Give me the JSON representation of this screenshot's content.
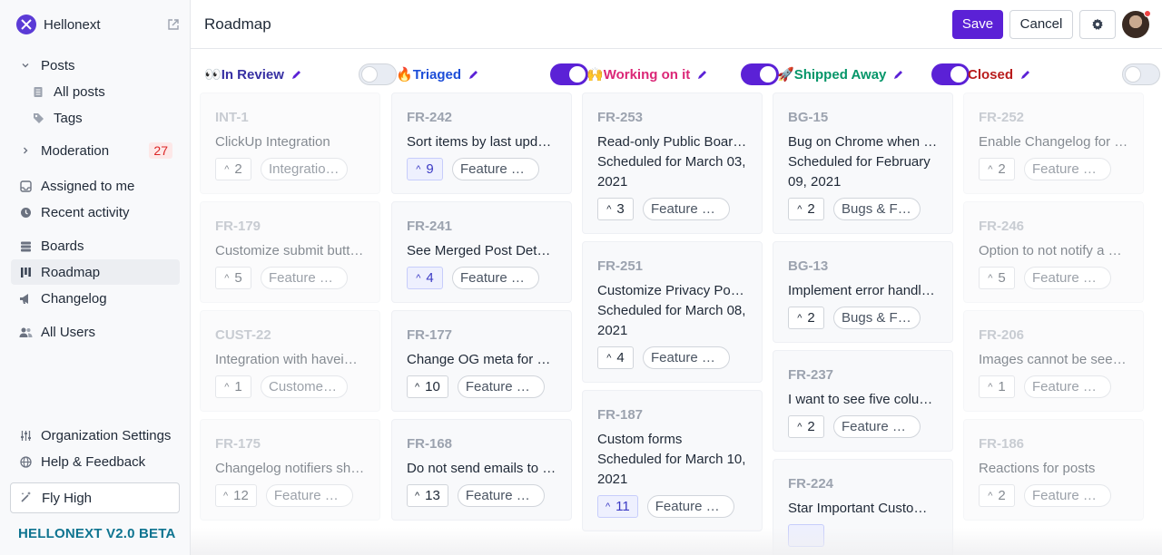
{
  "app": {
    "name": "Hellonext",
    "version_label": "HELLONEXT V2.0 BETA",
    "colors": {
      "accent": "#5b21d6",
      "badge_red": "#dc2626",
      "version_teal": "#0e7490"
    }
  },
  "sidebar": {
    "posts_label": "Posts",
    "all_posts_label": "All posts",
    "tags_label": "Tags",
    "moderation_label": "Moderation",
    "moderation_count": "27",
    "assigned_label": "Assigned to me",
    "recent_label": "Recent activity",
    "boards_label": "Boards",
    "roadmap_label": "Roadmap",
    "changelog_label": "Changelog",
    "all_users_label": "All Users",
    "org_settings_label": "Organization Settings",
    "help_label": "Help & Feedback",
    "fly_label": "Fly High"
  },
  "header": {
    "title": "Roadmap",
    "save_label": "Save",
    "cancel_label": "Cancel"
  },
  "columns": [
    {
      "emoji": "👀",
      "name": "In Review",
      "color": "#3730a3",
      "enabled": false,
      "cards": [
        {
          "id": "INT-1",
          "title": "ClickUp Integration",
          "votes": "2",
          "tag": "Integrations"
        },
        {
          "id": "FR-179",
          "title": "Customize submit button text",
          "votes": "5",
          "tag": "Feature Request"
        },
        {
          "id": "CUST-22",
          "title": "Integration with haveibeenpwned",
          "votes": "1",
          "tag": "Customer Feedback"
        },
        {
          "id": "FR-175",
          "title": "Changelog notifiers should",
          "votes": "12",
          "tag": "Feature Request"
        }
      ]
    },
    {
      "emoji": "🔥",
      "name": "Triaged",
      "color": "#1d4ed8",
      "enabled": true,
      "cards": [
        {
          "id": "FR-242",
          "title": "Sort items by last updated",
          "votes": "9",
          "tag": "Feature Request"
        },
        {
          "id": "FR-241",
          "title": "See Merged Post Details",
          "votes": "4",
          "tag": "Feature Request"
        },
        {
          "id": "FR-177",
          "title": "Change OG meta for public",
          "votes": "10",
          "tag": "Feature Request"
        },
        {
          "id": "FR-168",
          "title": "Do not send emails to when",
          "votes": "13",
          "tag": "Feature Request"
        }
      ]
    },
    {
      "emoji": "🙌",
      "name": "Working on it",
      "color": "#db2777",
      "enabled": true,
      "cards": [
        {
          "id": "FR-253",
          "title": "Read-only Public Boards",
          "scheduled": [
            "Scheduled for March 03,",
            "2021"
          ],
          "votes": "3",
          "tag": "Feature Request"
        },
        {
          "id": "FR-251",
          "title": "Customize Privacy Policy",
          "scheduled": [
            "Scheduled for March 08,",
            "2021"
          ],
          "votes": "4",
          "tag": "Feature Request"
        },
        {
          "id": "FR-187",
          "title": "Custom forms",
          "scheduled": [
            "Scheduled for March 10,",
            "2021"
          ],
          "votes": "11",
          "tag": "Feature Request"
        }
      ]
    },
    {
      "emoji": "🚀",
      "name": "Shipped Away",
      "color": "#059669",
      "enabled": true,
      "cards": [
        {
          "id": "BG-15",
          "title": "Bug on Chrome when trying",
          "scheduled": [
            "Scheduled for February",
            "09, 2021"
          ],
          "votes": "2",
          "tag": "Bugs & Fixes"
        },
        {
          "id": "BG-13",
          "title": "Implement error handling",
          "votes": "2",
          "tag": "Bugs & Fixes"
        },
        {
          "id": "FR-237",
          "title": "I want to see five columns",
          "votes": "2",
          "tag": "Feature Request"
        },
        {
          "id": "FR-224",
          "title": "Star Important Customers",
          "votes": "",
          "tag": ""
        }
      ]
    },
    {
      "emoji": "",
      "name": "Closed",
      "color": "#b91c1c",
      "enabled": false,
      "cards": [
        {
          "id": "FR-252",
          "title": "Enable Changelog for Posts",
          "votes": "2",
          "tag": "Feature Request"
        },
        {
          "id": "FR-246",
          "title": "Option to not notify a user",
          "votes": "5",
          "tag": "Feature Request"
        },
        {
          "id": "FR-206",
          "title": "Images cannot be seen in",
          "votes": "1",
          "tag": "Feature Request"
        },
        {
          "id": "FR-186",
          "title": "Reactions for posts",
          "votes": "2",
          "tag": "Feature Request"
        }
      ]
    }
  ]
}
